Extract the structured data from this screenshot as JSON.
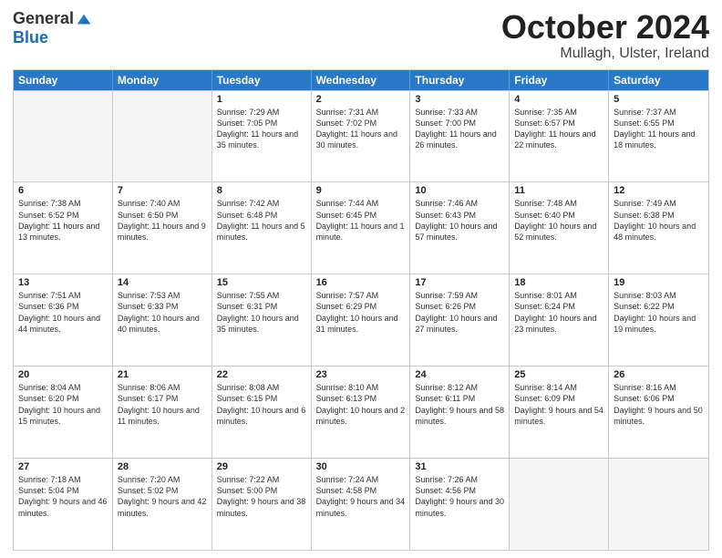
{
  "logo": {
    "general": "General",
    "blue": "Blue"
  },
  "title": "October 2024",
  "location": "Mullagh, Ulster, Ireland",
  "days_of_week": [
    "Sunday",
    "Monday",
    "Tuesday",
    "Wednesday",
    "Thursday",
    "Friday",
    "Saturday"
  ],
  "rows": [
    [
      {
        "day": "",
        "empty": true,
        "sunrise": "",
        "sunset": "",
        "daylight": ""
      },
      {
        "day": "",
        "empty": true,
        "sunrise": "",
        "sunset": "",
        "daylight": ""
      },
      {
        "day": "1",
        "empty": false,
        "sunrise": "Sunrise: 7:29 AM",
        "sunset": "Sunset: 7:05 PM",
        "daylight": "Daylight: 11 hours and 35 minutes."
      },
      {
        "day": "2",
        "empty": false,
        "sunrise": "Sunrise: 7:31 AM",
        "sunset": "Sunset: 7:02 PM",
        "daylight": "Daylight: 11 hours and 30 minutes."
      },
      {
        "day": "3",
        "empty": false,
        "sunrise": "Sunrise: 7:33 AM",
        "sunset": "Sunset: 7:00 PM",
        "daylight": "Daylight: 11 hours and 26 minutes."
      },
      {
        "day": "4",
        "empty": false,
        "sunrise": "Sunrise: 7:35 AM",
        "sunset": "Sunset: 6:57 PM",
        "daylight": "Daylight: 11 hours and 22 minutes."
      },
      {
        "day": "5",
        "empty": false,
        "sunrise": "Sunrise: 7:37 AM",
        "sunset": "Sunset: 6:55 PM",
        "daylight": "Daylight: 11 hours and 18 minutes."
      }
    ],
    [
      {
        "day": "6",
        "empty": false,
        "sunrise": "Sunrise: 7:38 AM",
        "sunset": "Sunset: 6:52 PM",
        "daylight": "Daylight: 11 hours and 13 minutes."
      },
      {
        "day": "7",
        "empty": false,
        "sunrise": "Sunrise: 7:40 AM",
        "sunset": "Sunset: 6:50 PM",
        "daylight": "Daylight: 11 hours and 9 minutes."
      },
      {
        "day": "8",
        "empty": false,
        "sunrise": "Sunrise: 7:42 AM",
        "sunset": "Sunset: 6:48 PM",
        "daylight": "Daylight: 11 hours and 5 minutes."
      },
      {
        "day": "9",
        "empty": false,
        "sunrise": "Sunrise: 7:44 AM",
        "sunset": "Sunset: 6:45 PM",
        "daylight": "Daylight: 11 hours and 1 minute."
      },
      {
        "day": "10",
        "empty": false,
        "sunrise": "Sunrise: 7:46 AM",
        "sunset": "Sunset: 6:43 PM",
        "daylight": "Daylight: 10 hours and 57 minutes."
      },
      {
        "day": "11",
        "empty": false,
        "sunrise": "Sunrise: 7:48 AM",
        "sunset": "Sunset: 6:40 PM",
        "daylight": "Daylight: 10 hours and 52 minutes."
      },
      {
        "day": "12",
        "empty": false,
        "sunrise": "Sunrise: 7:49 AM",
        "sunset": "Sunset: 6:38 PM",
        "daylight": "Daylight: 10 hours and 48 minutes."
      }
    ],
    [
      {
        "day": "13",
        "empty": false,
        "sunrise": "Sunrise: 7:51 AM",
        "sunset": "Sunset: 6:36 PM",
        "daylight": "Daylight: 10 hours and 44 minutes."
      },
      {
        "day": "14",
        "empty": false,
        "sunrise": "Sunrise: 7:53 AM",
        "sunset": "Sunset: 6:33 PM",
        "daylight": "Daylight: 10 hours and 40 minutes."
      },
      {
        "day": "15",
        "empty": false,
        "sunrise": "Sunrise: 7:55 AM",
        "sunset": "Sunset: 6:31 PM",
        "daylight": "Daylight: 10 hours and 35 minutes."
      },
      {
        "day": "16",
        "empty": false,
        "sunrise": "Sunrise: 7:57 AM",
        "sunset": "Sunset: 6:29 PM",
        "daylight": "Daylight: 10 hours and 31 minutes."
      },
      {
        "day": "17",
        "empty": false,
        "sunrise": "Sunrise: 7:59 AM",
        "sunset": "Sunset: 6:26 PM",
        "daylight": "Daylight: 10 hours and 27 minutes."
      },
      {
        "day": "18",
        "empty": false,
        "sunrise": "Sunrise: 8:01 AM",
        "sunset": "Sunset: 6:24 PM",
        "daylight": "Daylight: 10 hours and 23 minutes."
      },
      {
        "day": "19",
        "empty": false,
        "sunrise": "Sunrise: 8:03 AM",
        "sunset": "Sunset: 6:22 PM",
        "daylight": "Daylight: 10 hours and 19 minutes."
      }
    ],
    [
      {
        "day": "20",
        "empty": false,
        "sunrise": "Sunrise: 8:04 AM",
        "sunset": "Sunset: 6:20 PM",
        "daylight": "Daylight: 10 hours and 15 minutes."
      },
      {
        "day": "21",
        "empty": false,
        "sunrise": "Sunrise: 8:06 AM",
        "sunset": "Sunset: 6:17 PM",
        "daylight": "Daylight: 10 hours and 11 minutes."
      },
      {
        "day": "22",
        "empty": false,
        "sunrise": "Sunrise: 8:08 AM",
        "sunset": "Sunset: 6:15 PM",
        "daylight": "Daylight: 10 hours and 6 minutes."
      },
      {
        "day": "23",
        "empty": false,
        "sunrise": "Sunrise: 8:10 AM",
        "sunset": "Sunset: 6:13 PM",
        "daylight": "Daylight: 10 hours and 2 minutes."
      },
      {
        "day": "24",
        "empty": false,
        "sunrise": "Sunrise: 8:12 AM",
        "sunset": "Sunset: 6:11 PM",
        "daylight": "Daylight: 9 hours and 58 minutes."
      },
      {
        "day": "25",
        "empty": false,
        "sunrise": "Sunrise: 8:14 AM",
        "sunset": "Sunset: 6:09 PM",
        "daylight": "Daylight: 9 hours and 54 minutes."
      },
      {
        "day": "26",
        "empty": false,
        "sunrise": "Sunrise: 8:16 AM",
        "sunset": "Sunset: 6:06 PM",
        "daylight": "Daylight: 9 hours and 50 minutes."
      }
    ],
    [
      {
        "day": "27",
        "empty": false,
        "sunrise": "Sunrise: 7:18 AM",
        "sunset": "Sunset: 5:04 PM",
        "daylight": "Daylight: 9 hours and 46 minutes."
      },
      {
        "day": "28",
        "empty": false,
        "sunrise": "Sunrise: 7:20 AM",
        "sunset": "Sunset: 5:02 PM",
        "daylight": "Daylight: 9 hours and 42 minutes."
      },
      {
        "day": "29",
        "empty": false,
        "sunrise": "Sunrise: 7:22 AM",
        "sunset": "Sunset: 5:00 PM",
        "daylight": "Daylight: 9 hours and 38 minutes."
      },
      {
        "day": "30",
        "empty": false,
        "sunrise": "Sunrise: 7:24 AM",
        "sunset": "Sunset: 4:58 PM",
        "daylight": "Daylight: 9 hours and 34 minutes."
      },
      {
        "day": "31",
        "empty": false,
        "sunrise": "Sunrise: 7:26 AM",
        "sunset": "Sunset: 4:56 PM",
        "daylight": "Daylight: 9 hours and 30 minutes."
      },
      {
        "day": "",
        "empty": true,
        "sunrise": "",
        "sunset": "",
        "daylight": ""
      },
      {
        "day": "",
        "empty": true,
        "sunrise": "",
        "sunset": "",
        "daylight": ""
      }
    ]
  ]
}
